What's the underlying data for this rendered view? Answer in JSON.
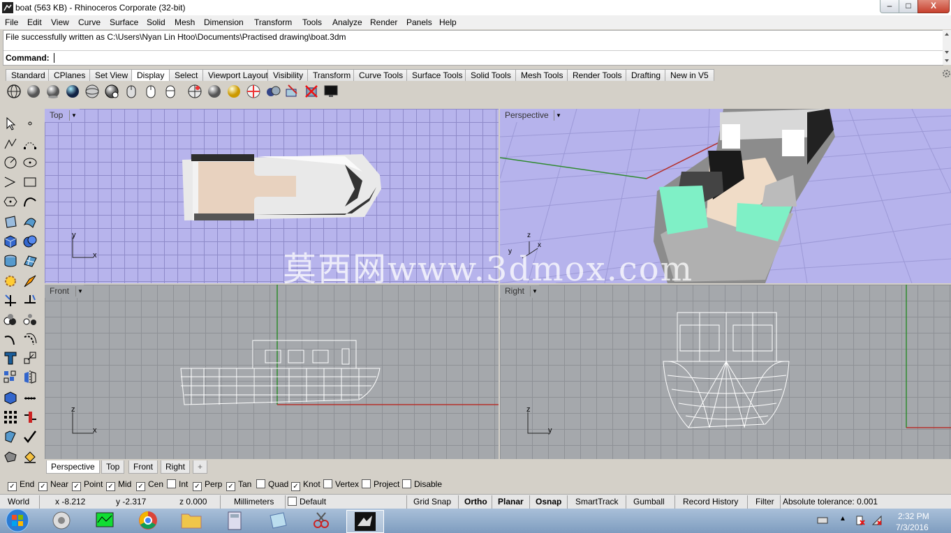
{
  "window": {
    "title": "boat (563 KB) - Rhinoceros Corporate (32-bit)",
    "min": "–",
    "max": "□",
    "close": "X"
  },
  "menu": [
    "File",
    "Edit",
    "View",
    "Curve",
    "Surface",
    "Solid",
    "Mesh",
    "Dimension",
    "Transform",
    "Tools",
    "Analyze",
    "Render",
    "Panels",
    "Help"
  ],
  "command": {
    "history": "File successfully written as C:\\Users\\Nyan Lin Htoo\\Documents\\Practised drawing\\boat.3dm",
    "prompt": "Command:",
    "value": ""
  },
  "toolbar_tabs": [
    "Standard",
    "CPlanes",
    "Set View",
    "Display",
    "Select",
    "Viewport Layout",
    "Visibility",
    "Transform",
    "Curve Tools",
    "Surface Tools",
    "Solid Tools",
    "Mesh Tools",
    "Render Tools",
    "Drafting",
    "New in V5"
  ],
  "active_toolbar_tab": "Display",
  "viewports": {
    "top": {
      "label": "Top",
      "axes": [
        "y",
        "x"
      ]
    },
    "perspective": {
      "label": "Perspective",
      "axes": [
        "z",
        "y",
        "x"
      ]
    },
    "front": {
      "label": "Front",
      "axes": [
        "z",
        "x"
      ]
    },
    "right": {
      "label": "Right",
      "axes": [
        "z",
        "y"
      ]
    }
  },
  "viewport_tabs": [
    "Perspective",
    "Top",
    "Front",
    "Right"
  ],
  "viewport_tab_add": "+",
  "active_viewport_tab": "Perspective",
  "osnaps": [
    {
      "label": "End",
      "checked": true
    },
    {
      "label": "Near",
      "checked": true
    },
    {
      "label": "Point",
      "checked": true
    },
    {
      "label": "Mid",
      "checked": true
    },
    {
      "label": "Cen",
      "checked": true
    },
    {
      "label": "Int",
      "checked": false
    },
    {
      "label": "Perp",
      "checked": true
    },
    {
      "label": "Tan",
      "checked": true
    },
    {
      "label": "Quad",
      "checked": false
    },
    {
      "label": "Knot",
      "checked": true
    },
    {
      "label": "Vertex",
      "checked": false
    },
    {
      "label": "Project",
      "checked": false
    },
    {
      "label": "Disable",
      "checked": false
    }
  ],
  "status": {
    "cplane": "World",
    "x": "x -8.212",
    "y": "y -2.317",
    "z": "z 0.000",
    "units": "Millimeters",
    "layer": "Default",
    "grid_snap": "Grid Snap",
    "ortho": "Ortho",
    "planar": "Planar",
    "osnap": "Osnap",
    "smarttrack": "SmartTrack",
    "gumball": "Gumball",
    "record_history": "Record History",
    "filter": "Filter",
    "tolerance": "Absolute tolerance: 0.001"
  },
  "clock": {
    "time": "2:32 PM",
    "date": "7/3/2016"
  },
  "watermark": "莫西网www.3dmox.com",
  "colors": {
    "top_bg": "#b7b4ec",
    "front_bg": "#a5a8ac",
    "x_axis": "#b5302b",
    "y_axis": "#2f8a2f",
    "mint": "#7ff0c6"
  }
}
